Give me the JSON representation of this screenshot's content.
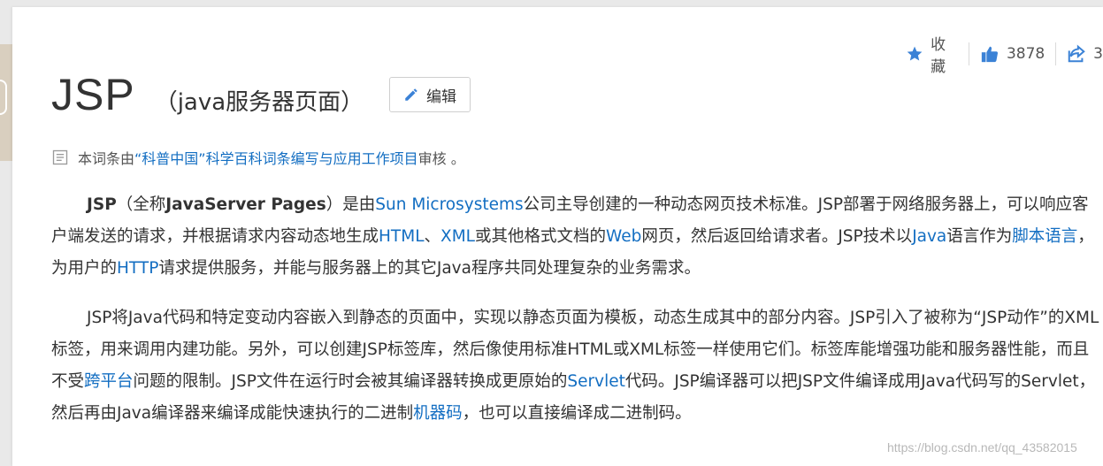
{
  "title": {
    "main": "JSP",
    "sub": "（java服务器页面）"
  },
  "edit_button": {
    "label": "编辑"
  },
  "actions": {
    "favorite_label": "收藏",
    "like_count": "3878",
    "share_count": "3"
  },
  "source": {
    "prefix": "本词条由",
    "link": "“科普中国”科学百科词条编写与应用工作项目",
    "suffix": " 审核 。"
  },
  "para1": {
    "t1": "JSP",
    "t2": "（全称",
    "t3": "JavaServer Pages",
    "t4": "）是由",
    "l1": "Sun Microsystems",
    "t5": "公司主导创建的一种动态网页技术标准。JSP部署于网络服务器上，可以响应客户端发送的请求，并根据请求内容动态地生成",
    "l2": "HTML",
    "t6": "、",
    "l3": "XML",
    "t7": "或其他格式文档的",
    "l4": "Web",
    "t8": "网页，然后返回给请求者。JSP技术以",
    "l5": "Java",
    "t9": "语言作为",
    "l6": "脚本语言",
    "t10": "，为用户的",
    "l7": "HTTP",
    "t11": "请求提供服务，并能与服务器上的其它Java程序共同处理复杂的业务需求。"
  },
  "para2": {
    "t1": "JSP将Java代码和特定变动内容嵌入到静态的页面中，实现以静态页面为模板，动态生成其中的部分内容。JSP引入了被称为“JSP动作”的XML标签，用来调用内建功能。另外，可以创建JSP标签库，然后像使用标准HTML或XML标签一样使用它们。标签库能增强功能和服务器性能，而且不受",
    "l1": "跨平台",
    "t2": "问题的限制。JSP文件在运行时会被其编译器转换成更原始的",
    "l2": "Servlet",
    "t3": "代码。JSP编译器可以把JSP文件编译成用Java代码写的Servlet，然后再由Java编译器来编译成能快速执行的二进制",
    "l3": "机器码",
    "t4": "，也可以直接编译成二进制码。"
  },
  "watermark": "https://blog.csdn.net/qq_43582015",
  "colors": {
    "link": "#136ec2",
    "icon": "#3b82d6",
    "text": "#333333"
  }
}
